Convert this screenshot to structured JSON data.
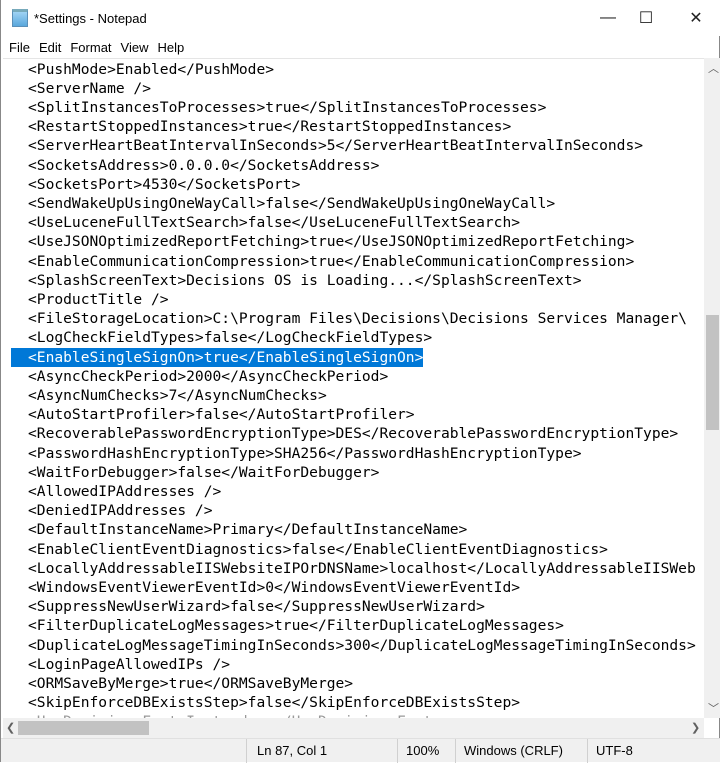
{
  "window": {
    "title": "*Settings - Notepad",
    "minimize": "—",
    "maximize": "☐",
    "close": "✕"
  },
  "menu": [
    "File",
    "Edit",
    "Format",
    "View",
    "Help"
  ],
  "lines": [
    "<PushMode>Enabled</PushMode>",
    "<ServerName />",
    "<SplitInstancesToProcesses>true</SplitInstancesToProcesses>",
    "<RestartStoppedInstances>true</RestartStoppedInstances>",
    "<ServerHeartBeatIntervalInSeconds>5</ServerHeartBeatIntervalInSeconds>",
    "<SocketsAddress>0.0.0.0</SocketsAddress>",
    "<SocketsPort>4530</SocketsPort>",
    "<SendWakeUpUsingOneWayCall>false</SendWakeUpUsingOneWayCall>",
    "<UseLuceneFullTextSearch>false</UseLuceneFullTextSearch>",
    "<UseJSONOptimizedReportFetching>true</UseJSONOptimizedReportFetching>",
    "<EnableCommunicationCompression>true</EnableCommunicationCompression>",
    "<SplashScreenText>Decisions OS is Loading...</SplashScreenText>",
    "<ProductTitle />",
    "<FileStorageLocation>C:\\Program Files\\Decisions\\Decisions Services Manager\\",
    "<LogCheckFieldTypes>false</LogCheckFieldTypes>",
    "<EnableSingleSignOn>true</EnableSingleSignOn>",
    "<AsyncCheckPeriod>2000</AsyncCheckPeriod>",
    "<AsyncNumChecks>7</AsyncNumChecks>",
    "<AutoStartProfiler>false</AutoStartProfiler>",
    "<RecoverablePasswordEncryptionType>DES</RecoverablePasswordEncryptionType>",
    "<PasswordHashEncryptionType>SHA256</PasswordHashEncryptionType>",
    "<WaitForDebugger>false</WaitForDebugger>",
    "<AllowedIPAddresses />",
    "<DeniedIPAddresses />",
    "<DefaultInstanceName>Primary</DefaultInstanceName>",
    "<EnableClientEventDiagnostics>false</EnableClientEventDiagnostics>",
    "<LocallyAddressableIISWebsiteIPOrDNSName>localhost</LocallyAddressableIISWeb",
    "<WindowsEventViewerEventId>0</WindowsEventViewerEventId>",
    "<SuppressNewUserWizard>false</SuppressNewUserWizard>",
    "<FilterDuplicateLogMessages>true</FilterDuplicateLogMessages>",
    "<DuplicateLogMessageTimingInSeconds>300</DuplicateLogMessageTimingInSeconds>",
    "<LoginPageAllowedIPs />",
    "<ORMSaveByMerge>true</ORMSaveByMerge>",
    "<SkipEnforceDBExistsStep>false</SkipEnforceDBExistsStep>",
    "<UseDecisionsFontsInstead...</UseDecisionsFonts>"
  ],
  "selected_line": 15,
  "status": {
    "position": "Ln 87, Col 1",
    "zoom": "100%",
    "line_ending": "Windows (CRLF)",
    "encoding": "UTF-8"
  },
  "colors": {
    "selection": "#0078d7"
  }
}
